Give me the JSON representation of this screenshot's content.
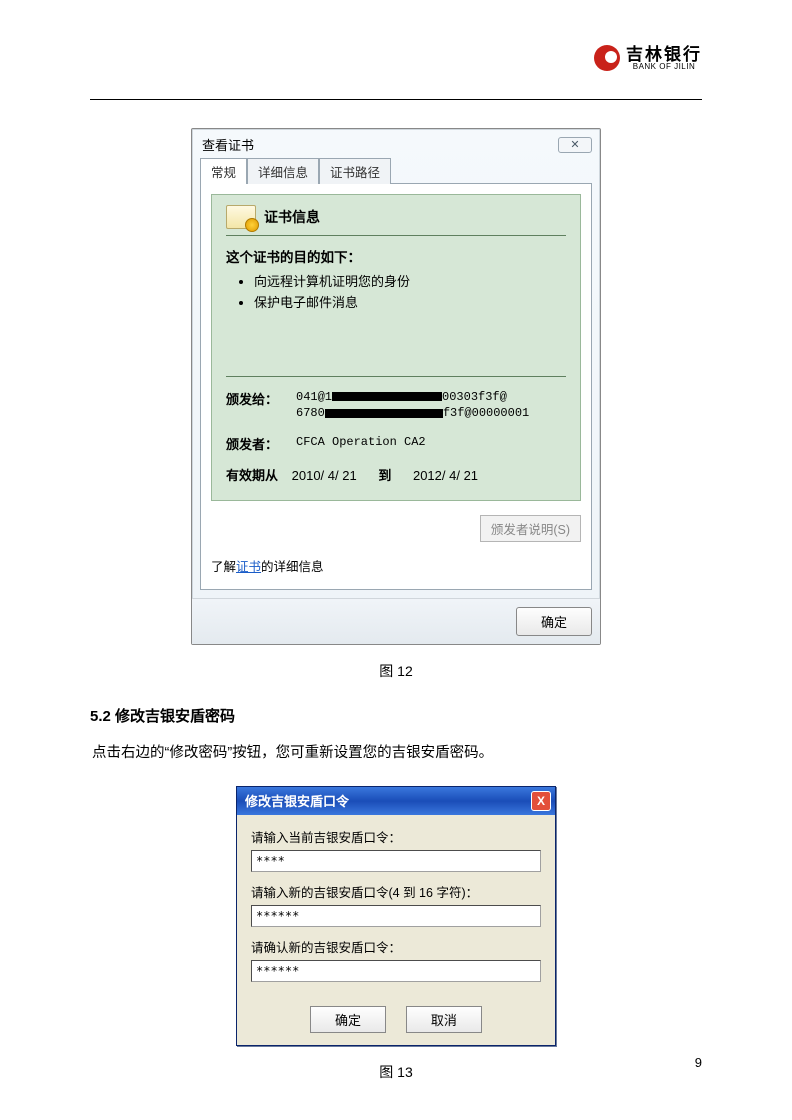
{
  "brand": {
    "cn": "吉林银行",
    "en": "BANK OF JILIN"
  },
  "cert_dialog": {
    "title": "查看证书",
    "close_glyph": "✕",
    "tabs": {
      "general": "常规",
      "details": "详细信息",
      "path": "证书路径"
    },
    "info_title": "证书信息",
    "purpose_head": "这个证书的目的如下：",
    "purposes": [
      "向远程计算机证明您的身份",
      "保护电子邮件消息"
    ],
    "issued_to_label": "颁发给：",
    "issued_to_line1_a": "041@1",
    "issued_to_line1_b": "00303f3f@",
    "issued_to_line2_a": "6780",
    "issued_to_line2_b": "f3f@00000001",
    "issuer_label": "颁发者：",
    "issuer_value": "CFCA Operation CA2",
    "validity_label": "有效期从",
    "validity_from": "2010/ 4/ 21",
    "validity_to_label": "到",
    "validity_to": "2012/ 4/ 21",
    "issuer_statement_btn": "颁发者说明(S)",
    "learn_pre": "了解",
    "learn_link": "证书",
    "learn_post": "的详细信息",
    "ok": "确定"
  },
  "caption12": "图 12",
  "section_5_2": "5.2 修改吉银安盾密码",
  "section_5_2_body": "点击右边的“修改密码”按钮，您可重新设置您的吉银安盾密码。",
  "xp_dialog": {
    "title": "修改吉银安盾口令",
    "close_glyph": "X",
    "label_current": "请输入当前吉银安盾口令：",
    "value_current": "****",
    "label_new": "请输入新的吉银安盾口令(4 到 16 字符)：",
    "value_new": "******",
    "label_confirm": "请确认新的吉银安盾口令：",
    "value_confirm": "******",
    "ok": "确定",
    "cancel": "取消"
  },
  "caption13": "图 13",
  "page_number": "9"
}
